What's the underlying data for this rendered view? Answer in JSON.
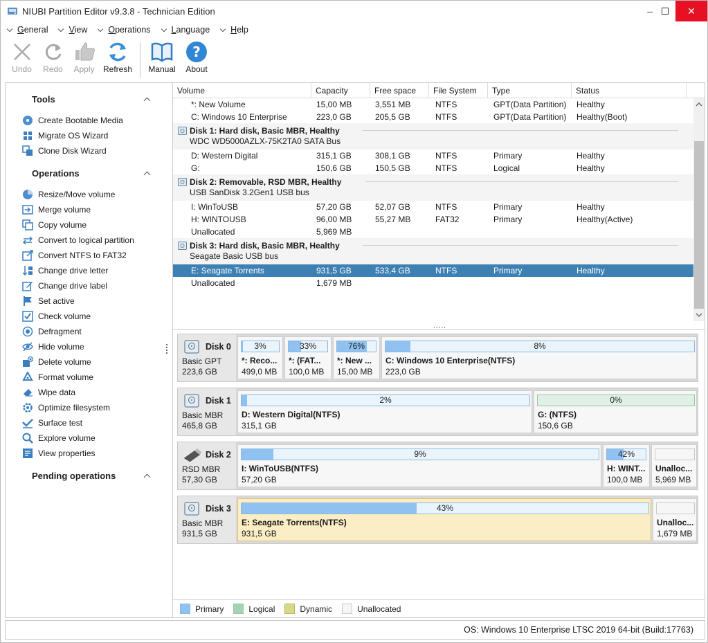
{
  "window": {
    "title": "NIUBI Partition Editor v9.3.8 - Technician Edition",
    "minimize": "–",
    "maximize": "□",
    "close": "✕"
  },
  "menu": [
    {
      "pre": "",
      "u": "G",
      "post": "eneral"
    },
    {
      "pre": "",
      "u": "V",
      "post": "iew"
    },
    {
      "pre": "",
      "u": "O",
      "post": "perations"
    },
    {
      "pre": "",
      "u": "L",
      "post": "anguage"
    },
    {
      "pre": "",
      "u": "H",
      "post": "elp"
    }
  ],
  "toolbar": {
    "undo": "Undo",
    "redo": "Redo",
    "apply": "Apply",
    "refresh": "Refresh",
    "manual": "Manual",
    "about": "About"
  },
  "left": {
    "tools_title": "Tools",
    "tools": [
      "Create Bootable Media",
      "Migrate OS Wizard",
      "Clone Disk Wizard"
    ],
    "operations_title": "Operations",
    "operations": [
      "Resize/Move volume",
      "Merge volume",
      "Copy volume",
      "Convert to logical partition",
      "Convert NTFS to FAT32",
      "Change drive letter",
      "Change drive label",
      "Set active",
      "Check volume",
      "Defragment",
      "Hide volume",
      "Delete volume",
      "Format volume",
      "Wipe data",
      "Optimize filesystem",
      "Surface test",
      "Explore volume",
      "View properties"
    ],
    "pending_title": "Pending operations"
  },
  "columns": [
    "Volume",
    "Capacity",
    "Free space",
    "File System",
    "Type",
    "Status"
  ],
  "list": {
    "r1": [
      "*: New Volume",
      "15,00 MB",
      "3,551 MB",
      "NTFS",
      "GPT(Data Partition)",
      "Healthy"
    ],
    "r2": [
      "C: Windows 10 Enterprise",
      "223,0 GB",
      "205,5 GB",
      "NTFS",
      "GPT(Data Partition)",
      "Healthy(Boot)"
    ],
    "d1": {
      "title": "Disk 1: Hard disk, Basic MBR, Healthy",
      "sub": "WDC WD5000AZLX-75K2TA0 SATA Bus"
    },
    "r3": [
      "D: Western Digital",
      "315,1 GB",
      "308,1 GB",
      "NTFS",
      "Primary",
      "Healthy"
    ],
    "r4": [
      "G:",
      "150,6 GB",
      "150,5 GB",
      "NTFS",
      "Logical",
      "Healthy"
    ],
    "d2": {
      "title": "Disk 2: Removable, RSD MBR, Healthy",
      "sub": "USB  SanDisk 3.2Gen1 USB bus"
    },
    "r5": [
      "I: WinToUSB",
      "57,20 GB",
      "52,07 GB",
      "NTFS",
      "Primary",
      "Healthy"
    ],
    "r6": [
      "H: WINTOUSB",
      "96,00 MB",
      "55,27 MB",
      "FAT32",
      "Primary",
      "Healthy(Active)"
    ],
    "r7": [
      "Unallocated",
      "5,969 MB",
      "",
      "",
      "",
      ""
    ],
    "d3": {
      "title": "Disk 3: Hard disk, Basic MBR, Healthy",
      "sub": "Seagate Basic USB bus"
    },
    "r8": [
      "E: Seagate Torrents",
      "931,5 GB",
      "533,4 GB",
      "NTFS",
      "Primary",
      "Healthy"
    ],
    "r9": [
      "Unallocated",
      "1,679 MB",
      "",
      "",
      "",
      ""
    ]
  },
  "more": ".....",
  "disks": {
    "d0": {
      "name": "Disk 0",
      "type": "Basic GPT",
      "size": "223,6 GB",
      "p": [
        {
          "pct": "3%",
          "fill": 0.03,
          "name": "*: Reco...",
          "size": "499,0 MB"
        },
        {
          "pct": "33%",
          "fill": 0.33,
          "name": "*: (FAT...",
          "size": "100,0 MB"
        },
        {
          "pct": "76%",
          "fill": 0.76,
          "name": "*: New ...",
          "size": "15,00 MB"
        },
        {
          "pct": "8%",
          "fill": 0.08,
          "name": "C: Windows 10 Enterprise(NTFS)",
          "size": "223,0 GB"
        }
      ]
    },
    "d1": {
      "name": "Disk 1",
      "type": "Basic MBR",
      "size": "465,8 GB",
      "p": [
        {
          "pct": "2%",
          "fill": 0.02,
          "name": "D: Western Digital(NTFS)",
          "size": "315,1 GB"
        },
        {
          "pct": "0%",
          "fill": 0.0,
          "name": "G: (NTFS)",
          "size": "150,6 GB"
        }
      ]
    },
    "d2": {
      "name": "Disk 2",
      "type": "RSD MBR",
      "size": "57,30 GB",
      "p": [
        {
          "pct": "9%",
          "fill": 0.09,
          "name": "I: WinToUSB(NTFS)",
          "size": "57,20 GB"
        },
        {
          "pct": "42%",
          "fill": 0.42,
          "name": "H: WINT...",
          "size": "100,0 MB"
        },
        {
          "pct": "",
          "fill": 0,
          "name": "Unalloc...",
          "size": "5,969 MB"
        }
      ]
    },
    "d3": {
      "name": "Disk 3",
      "type": "Basic MBR",
      "size": "931,5 GB",
      "p": [
        {
          "pct": "43%",
          "fill": 0.43,
          "name": "E: Seagate Torrents(NTFS)",
          "size": "931,5 GB"
        },
        {
          "pct": "",
          "fill": 0,
          "name": "Unalloc...",
          "size": "1,679 MB"
        }
      ]
    }
  },
  "legend": {
    "primary": "Primary",
    "logical": "Logical",
    "dynamic": "Dynamic",
    "unallocated": "Unallocated"
  },
  "status": "OS: Windows 10 Enterprise LTSC 2019 64-bit (Build:17763)",
  "colors": {
    "selection": "#3d80b4",
    "primary_fill": "#8fc2f0",
    "logical_fill": "#a5d3b4",
    "dynamic": "#d8d88a",
    "highlight_partition": "#fbeec4"
  }
}
